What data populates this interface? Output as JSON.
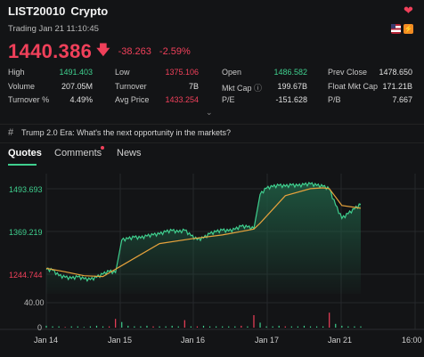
{
  "header": {
    "symbol": "LIST20010",
    "type": "Crypto",
    "trading_status": "Trading Jan 21 11:10:45",
    "price": "1440.386",
    "change": "-38.263",
    "change_pct": "-2.59%"
  },
  "stats": [
    {
      "label": "High",
      "value": "1491.403",
      "color": "green"
    },
    {
      "label": "Low",
      "value": "1375.106",
      "color": "red"
    },
    {
      "label": "Open",
      "value": "1486.582",
      "color": "green"
    },
    {
      "label": "Prev Close",
      "value": "1478.650",
      "color": "white"
    },
    {
      "label": "Volume",
      "value": "207.05M",
      "color": "white"
    },
    {
      "label": "Turnover",
      "value": "7B",
      "color": "white"
    },
    {
      "label": "Mkt Cap",
      "value": "199.67B",
      "color": "white"
    },
    {
      "label": "Float Mkt Cap",
      "value": "171.21B",
      "color": "white"
    },
    {
      "label": "Turnover %",
      "value": "4.49%",
      "color": "white"
    },
    {
      "label": "Avg Price",
      "value": "1433.254",
      "color": "red"
    },
    {
      "label": "P/E",
      "value": "-151.628",
      "color": "white"
    },
    {
      "label": "P/B",
      "value": "7.667",
      "color": "white"
    }
  ],
  "news_banner": "Trump 2.0 Era: What's the next opportunity in the markets?",
  "tabs": [
    "Quotes",
    "Comments",
    "News"
  ],
  "chart_data": {
    "type": "area",
    "x_ticks": [
      "Jan 14",
      "Jan 15",
      "Jan 16",
      "Jan 17",
      "Jan 21",
      "16:00"
    ],
    "y_ticks": [
      "1493.693",
      "1369.219",
      "1244.744"
    ],
    "volume_ticks": [
      "40.00",
      "0"
    ],
    "price_series": [
      [
        0,
        1282
      ],
      [
        1,
        1280
      ],
      [
        2,
        1266
      ],
      [
        3,
        1262
      ],
      [
        4,
        1259
      ],
      [
        5,
        1263
      ],
      [
        6,
        1258
      ],
      [
        7,
        1256
      ],
      [
        8,
        1262
      ],
      [
        9,
        1270
      ],
      [
        10,
        1277
      ],
      [
        11,
        1274
      ],
      [
        12,
        1357
      ],
      [
        13,
        1360
      ],
      [
        14,
        1364
      ],
      [
        15,
        1362
      ],
      [
        16,
        1367
      ],
      [
        17,
        1370
      ],
      [
        18,
        1372
      ],
      [
        19,
        1378
      ],
      [
        20,
        1381
      ],
      [
        21,
        1377
      ],
      [
        22,
        1382
      ],
      [
        23,
        1368
      ],
      [
        24,
        1358
      ],
      [
        25,
        1362
      ],
      [
        26,
        1373
      ],
      [
        27,
        1378
      ],
      [
        28,
        1382
      ],
      [
        29,
        1380
      ],
      [
        30,
        1384
      ],
      [
        31,
        1392
      ],
      [
        32,
        1390
      ],
      [
        33,
        1386
      ],
      [
        34,
        1473
      ],
      [
        35,
        1489
      ],
      [
        36,
        1493
      ],
      [
        37,
        1496
      ],
      [
        38,
        1494
      ],
      [
        39,
        1497
      ],
      [
        40,
        1495
      ],
      [
        41,
        1498
      ],
      [
        42,
        1500
      ],
      [
        43,
        1496
      ],
      [
        44,
        1494
      ],
      [
        45,
        1487
      ],
      [
        46,
        1446
      ],
      [
        47,
        1412
      ],
      [
        48,
        1424
      ],
      [
        49,
        1436
      ],
      [
        50,
        1448
      ]
    ],
    "avg_series": [
      [
        0,
        1285
      ],
      [
        3,
        1276
      ],
      [
        6,
        1266
      ],
      [
        9,
        1264
      ],
      [
        12,
        1292
      ],
      [
        18,
        1348
      ],
      [
        23,
        1360
      ],
      [
        28,
        1370
      ],
      [
        33,
        1385
      ],
      [
        34,
        1400
      ],
      [
        38,
        1470
      ],
      [
        42,
        1488
      ],
      [
        44,
        1490
      ],
      [
        45,
        1488
      ],
      [
        47,
        1445
      ],
      [
        50,
        1438
      ]
    ],
    "volume": [
      3,
      2,
      2,
      1,
      2,
      2,
      1,
      2,
      3,
      2,
      2,
      14,
      9,
      3,
      2,
      2,
      3,
      2,
      2,
      2,
      3,
      2,
      12,
      2,
      2,
      3,
      2,
      2,
      2,
      2,
      2,
      3,
      2,
      20,
      8,
      2,
      2,
      3,
      2,
      2,
      2,
      3,
      2,
      2,
      2,
      24,
      6,
      3,
      2,
      2,
      2
    ],
    "colors": {
      "line": "#3fcf8e",
      "avg": "#e6a23c",
      "fill_top": "#1f5a42",
      "volume_up": "#3fcf8e",
      "volume_down": "#f0405a"
    }
  }
}
